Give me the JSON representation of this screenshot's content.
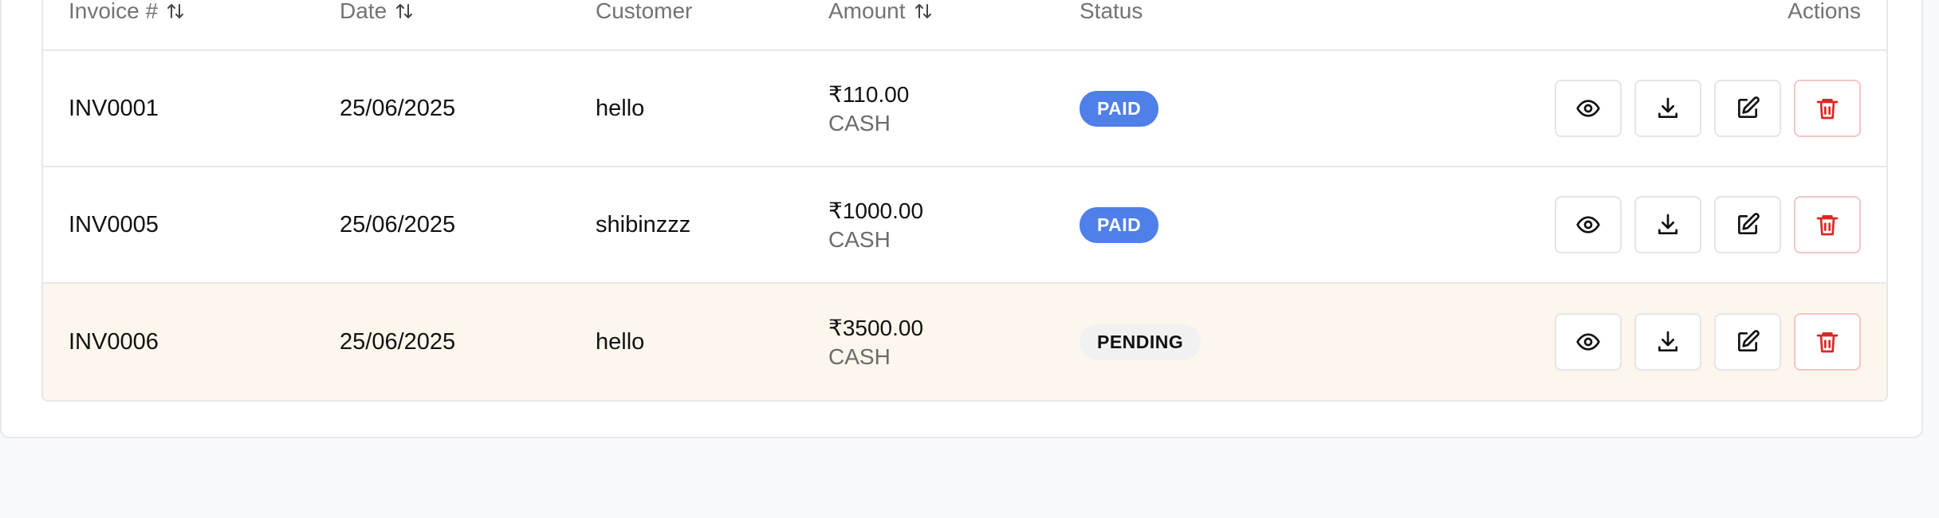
{
  "table": {
    "headers": {
      "invoice": "Invoice #",
      "date": "Date",
      "customer": "Customer",
      "amount": "Amount",
      "status": "Status",
      "actions": "Actions"
    },
    "rows": [
      {
        "invoice": "INV0001",
        "date": "25/06/2025",
        "customer": "hello",
        "amount": "₹110.00",
        "method": "CASH",
        "status": "PAID",
        "highlighted": false
      },
      {
        "invoice": "INV0005",
        "date": "25/06/2025",
        "customer": "shibinzzz",
        "amount": "₹1000.00",
        "method": "CASH",
        "status": "PAID",
        "highlighted": false
      },
      {
        "invoice": "INV0006",
        "date": "25/06/2025",
        "customer": "hello",
        "amount": "₹3500.00",
        "method": "CASH",
        "status": "PENDING",
        "highlighted": true
      }
    ]
  },
  "icons": {
    "sort": "sort-arrows-icon",
    "view": "eye-icon",
    "download": "download-icon",
    "edit": "edit-icon",
    "delete": "trash-icon"
  },
  "colors": {
    "paid_badge": "#4f7fe8",
    "pending_badge": "#f1f1f1",
    "highlight_row": "#fdf6ec",
    "delete_icon": "#dc2626"
  }
}
